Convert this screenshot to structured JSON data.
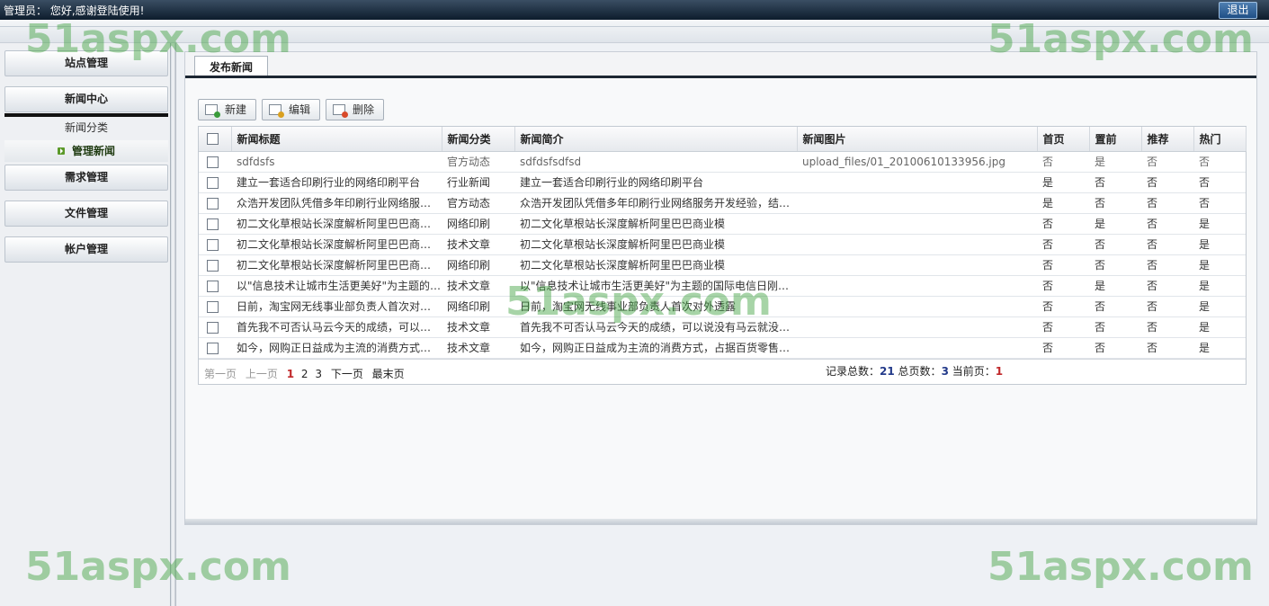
{
  "header": {
    "greeting": "管理员： 您好,感谢登陆使用!",
    "logout_label": "退出"
  },
  "sidebar": {
    "site_mgmt": "站点管理",
    "news_center": "新闻中心",
    "news_category": "新闻分类",
    "manage_news": "管理新闻",
    "demand_mgmt": "需求管理",
    "file_mgmt": "文件管理",
    "account_mgmt": "帐户管理"
  },
  "tabs": {
    "publish_news": "发布新闻"
  },
  "toolbar": {
    "new_label": "新建",
    "edit_label": "编辑",
    "delete_label": "删除"
  },
  "table": {
    "columns": [
      "新闻标题",
      "新闻分类",
      "新闻简介",
      "新闻图片",
      "首页",
      "置前",
      "推荐",
      "热门"
    ],
    "rows": [
      [
        "sdfdsfs",
        "官方动态",
        "sdfdsfsdfsd",
        "upload_files/01_20100610133956.jpg",
        "否",
        "是",
        "否",
        "否"
      ],
      [
        "建立一套适合印刷行业的网络印刷平台",
        "行业新闻",
        "建立一套适合印刷行业的网络印刷平台",
        "",
        "是",
        "否",
        "否",
        "否"
      ],
      [
        "众浩开发团队凭借多年印刷行业网络服…",
        "官方动态",
        "众浩开发团队凭借多年印刷行业网络服务开发经验，结…",
        "",
        "是",
        "否",
        "否",
        "否"
      ],
      [
        "初二文化草根站长深度解析阿里巴巴商…",
        "网络印刷",
        "初二文化草根站长深度解析阿里巴巴商业模",
        "",
        "否",
        "是",
        "否",
        "是"
      ],
      [
        "初二文化草根站长深度解析阿里巴巴商…",
        "技术文章",
        "初二文化草根站长深度解析阿里巴巴商业模",
        "",
        "否",
        "否",
        "否",
        "是"
      ],
      [
        "初二文化草根站长深度解析阿里巴巴商…",
        "网络印刷",
        "初二文化草根站长深度解析阿里巴巴商业模",
        "",
        "否",
        "否",
        "否",
        "是"
      ],
      [
        "以\"信息技术让城市生活更美好\"为主题的…",
        "技术文章",
        "以\"信息技术让城市生活更美好\"为主题的国际电信日刚…",
        "",
        "否",
        "是",
        "否",
        "是"
      ],
      [
        "日前，淘宝网无线事业部负责人首次对…",
        "网络印刷",
        "日前，淘宝网无线事业部负责人首次对外透露",
        "",
        "否",
        "否",
        "否",
        "是"
      ],
      [
        "首先我不可否认马云今天的成绩，可以…",
        "技术文章",
        "首先我不可否认马云今天的成绩，可以说没有马云就没…",
        "",
        "否",
        "否",
        "否",
        "是"
      ],
      [
        "如今，网购正日益成为主流的消费方式…",
        "技术文章",
        "如今，网购正日益成为主流的消费方式，占据百货零售…",
        "",
        "否",
        "否",
        "否",
        "是"
      ]
    ]
  },
  "pager": {
    "first": "第一页",
    "prev": "上一页",
    "page1": "1",
    "page2": "2",
    "page3": "3",
    "next": "下一页",
    "last": "最末页",
    "total_records_label": "记录总数：",
    "total_records": "21",
    "total_pages_label": "总页数：",
    "total_pages": "3",
    "current_page_label": "当前页：",
    "current_page": "1"
  },
  "watermark": {
    "text": "51aspx.com"
  }
}
